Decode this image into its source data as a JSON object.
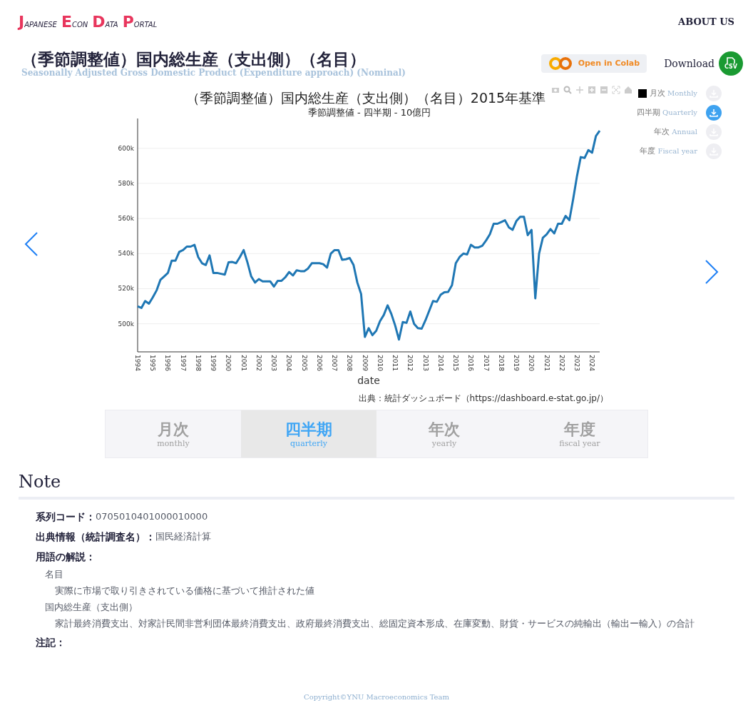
{
  "header": {
    "logo_words": [
      "JAPANESE",
      "ECON",
      "DATA",
      "PORTAL"
    ],
    "nav": [
      "ABOUT US"
    ]
  },
  "title": {
    "ja": "（季節調整値）国内総生産（支出側）（名目）",
    "en": "Seasonally Adjusted Gross Domestic Product (Expenditure approach) (Nominal)",
    "colab_button": "Open in Colab",
    "download_label": "Download",
    "download_badge": "CSV"
  },
  "chart": {
    "subtitle": "季節調整値 - 四半期 - 10億円",
    "source": "出典：統計ダッシュボード（https://dashboard.e-stat.go.jp/）",
    "chart_data": {
      "type": "line",
      "grid": true,
      "title": "（季節調整値）国内総生産（支出側）（名目）2015年基準",
      "xlabel": "date",
      "xlim": [
        1994,
        2024.5
      ],
      "ylim": [
        484000,
        617000
      ],
      "xticks": [
        1994,
        1995,
        1996,
        1997,
        1998,
        1999,
        2000,
        2001,
        2002,
        2003,
        2004,
        2005,
        2006,
        2007,
        2008,
        2009,
        2010,
        2011,
        2012,
        2013,
        2014,
        2015,
        2016,
        2017,
        2018,
        2019,
        2020,
        2021,
        2022,
        2023,
        2024
      ],
      "yticks": [
        {
          "value": 500000,
          "label": "500k"
        },
        {
          "value": 520000,
          "label": "520k"
        },
        {
          "value": 540000,
          "label": "540k"
        },
        {
          "value": 560000,
          "label": "560k"
        },
        {
          "value": 580000,
          "label": "580k"
        },
        {
          "value": 600000,
          "label": "600k"
        }
      ],
      "x": [
        1994,
        1994.25,
        1994.5,
        1994.75,
        1995,
        1995.25,
        1995.5,
        1995.75,
        1996,
        1996.25,
        1996.5,
        1996.75,
        1997,
        1997.25,
        1997.5,
        1997.75,
        1998,
        1998.25,
        1998.5,
        1998.75,
        1999,
        1999.25,
        1999.5,
        1999.75,
        2000,
        2000.25,
        2000.5,
        2000.75,
        2001,
        2001.25,
        2001.5,
        2001.75,
        2002,
        2002.25,
        2002.5,
        2002.75,
        2003,
        2003.25,
        2003.5,
        2003.75,
        2004,
        2004.25,
        2004.5,
        2004.75,
        2005,
        2005.25,
        2005.5,
        2005.75,
        2006,
        2006.25,
        2006.5,
        2006.75,
        2007,
        2007.25,
        2007.5,
        2007.75,
        2008,
        2008.25,
        2008.5,
        2008.75,
        2009,
        2009.25,
        2009.5,
        2009.75,
        2010,
        2010.25,
        2010.5,
        2010.75,
        2011,
        2011.25,
        2011.5,
        2011.75,
        2012,
        2012.25,
        2012.5,
        2012.75,
        2013,
        2013.25,
        2013.5,
        2013.75,
        2014,
        2014.25,
        2014.5,
        2014.75,
        2015,
        2015.25,
        2015.5,
        2015.75,
        2016,
        2016.25,
        2016.5,
        2016.75,
        2017,
        2017.25,
        2017.5,
        2017.75,
        2018,
        2018.25,
        2018.5,
        2018.75,
        2019,
        2019.25,
        2019.5,
        2019.75,
        2020,
        2020.25,
        2020.5,
        2020.75,
        2021,
        2021.25,
        2021.5,
        2021.75,
        2022,
        2022.25,
        2022.5,
        2022.75,
        2023,
        2023.25,
        2023.5,
        2023.75,
        2024,
        2024.25,
        2024.5
      ],
      "series": [
        {
          "color": "#1f77b4",
          "values": [
            510000,
            509000,
            513000,
            511500,
            515000,
            519000,
            525000,
            527000,
            529000,
            536000,
            536000,
            541000,
            542000,
            544000,
            544000,
            545000,
            538000,
            534500,
            533500,
            539000,
            529000,
            529000,
            528500,
            528000,
            535000,
            535200,
            534500,
            538000,
            542000,
            535000,
            527000,
            523500,
            525500,
            524200,
            524200,
            524200,
            521200,
            524500,
            524500,
            526500,
            529500,
            527500,
            530500,
            530000,
            530000,
            531500,
            534500,
            534500,
            534500,
            534000,
            532000,
            540000,
            542000,
            542000,
            536500,
            536800,
            537500,
            533500,
            523500,
            517000,
            492500,
            497500,
            493500,
            496000,
            501500,
            505000,
            510500,
            505500,
            499000,
            491000,
            501000,
            500500,
            507000,
            500000,
            497500,
            497200,
            502000,
            507500,
            513000,
            512500,
            516500,
            518000,
            518200,
            522000,
            534500,
            538000,
            540000,
            539500,
            545000,
            543500,
            543500,
            544500,
            547500,
            551000,
            557000,
            557000,
            558000,
            559000,
            555000,
            553500,
            558500,
            561000,
            561000,
            550500,
            553500,
            514500,
            540000,
            549000,
            551000,
            554000,
            551500,
            557000,
            557000,
            561500,
            559000,
            571000,
            584000,
            595000,
            594500,
            599000,
            597500,
            607000,
            610000
          ]
        }
      ]
    }
  },
  "frequencies": [
    {
      "ja": "月次",
      "en": "Monthly",
      "selected": false
    },
    {
      "ja": "四半期",
      "en": "Quarterly",
      "selected": true
    },
    {
      "ja": "年次",
      "en": "Annual",
      "selected": false
    },
    {
      "ja": "年度",
      "en": "Fiscal year",
      "selected": false
    }
  ],
  "tabs": [
    {
      "ja": "月次",
      "en": "monthly",
      "selected": false
    },
    {
      "ja": "四半期",
      "en": "quarterly",
      "selected": true
    },
    {
      "ja": "年次",
      "en": "yearly",
      "selected": false
    },
    {
      "ja": "年度",
      "en": "fiscal year",
      "selected": false
    }
  ],
  "note": {
    "heading": "Note",
    "fields": [
      {
        "label": "系列コード：",
        "value": "0705010401000010000"
      },
      {
        "label": "出典情報（統計調査名）：",
        "value": "国民経済計算"
      }
    ],
    "terms_label": "用語の解説：",
    "terms": [
      {
        "term": "名目",
        "definition": "実際に市場で取り引きされている価格に基づいて推計された値"
      },
      {
        "term": "国内総生産（支出側）",
        "definition": "家計最終消費支出、対家計民間非営利団体最終消費支出、政府最終消費支出、総固定資本形成、在庫変動、財貨・サービスの純輸出（輸出ー輸入）の合計"
      }
    ],
    "remarks_label": "注記："
  },
  "footer": "Copyright©YNU Macroeconomics Team"
}
